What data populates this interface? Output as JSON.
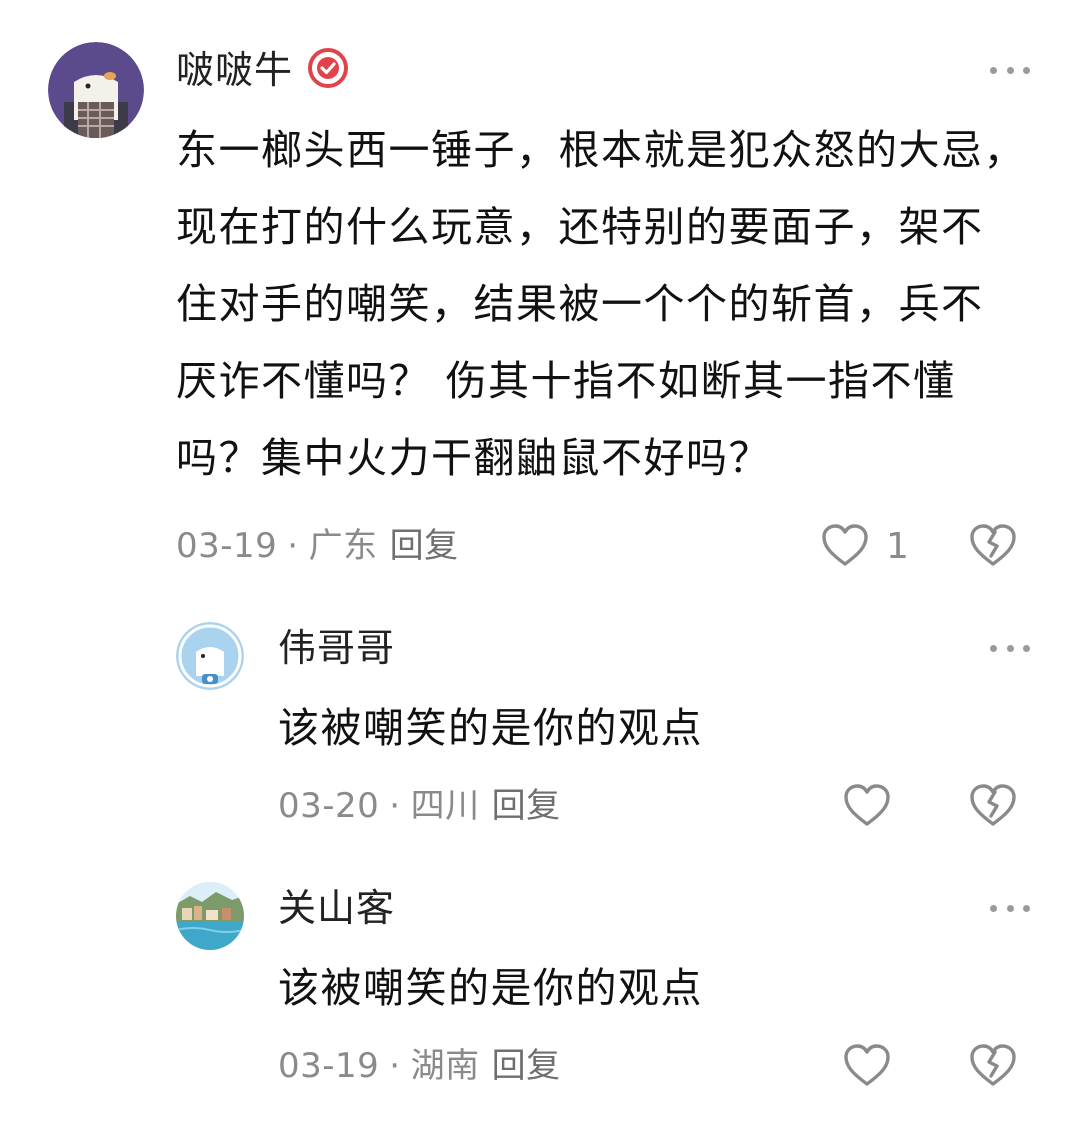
{
  "comments": [
    {
      "username": "啵啵牛",
      "verified_icon": "verified-badge-icon",
      "more_icon": "more-dots-icon",
      "text": "东一榔头西一锤子，根本就是犯众怒的大忌，现在打的什么玩意，还特别的要面子，架不住对手的嘲笑，结果被一个个的斩首，兵不厌诈不懂吗？ 伤其十指不如断其一指不懂吗？集中火力干翻鼬鼠不好吗？",
      "lines": [
        "东一榔头西一锤子，根本就是犯众怒的大忌，",
        "现在打的什么玩意，还特别的要面子，架不",
        "住对手的嘲笑，结果被一个个的斩首，兵不",
        "厌诈不懂吗？ 伤其十指不如断其一指不懂",
        "吗？集中火力干翻鼬鼠不好吗？"
      ],
      "date": "03-19",
      "location": "广东",
      "reply_label": "回复",
      "like_icon": "heart-icon",
      "like_count": "1",
      "dislike_icon": "broken-heart-icon"
    },
    {
      "username": "伟哥哥",
      "more_icon": "more-dots-icon",
      "text": "该被嘲笑的是你的观点",
      "date": "03-20",
      "location": "四川",
      "reply_label": "回复",
      "like_icon": "heart-icon",
      "dislike_icon": "broken-heart-icon"
    },
    {
      "username": "关山客",
      "more_icon": "more-dots-icon",
      "text": "该被嘲笑的是你的观点",
      "date": "03-19",
      "location": "湖南",
      "reply_label": "回复",
      "like_icon": "heart-icon",
      "dislike_icon": "broken-heart-icon"
    }
  ],
  "separator": "·",
  "colors": {
    "text_primary": "#111111",
    "text_secondary": "#8a8a8a",
    "icon_gray": "#9a9a9a",
    "verified_red": "#e0434a"
  }
}
